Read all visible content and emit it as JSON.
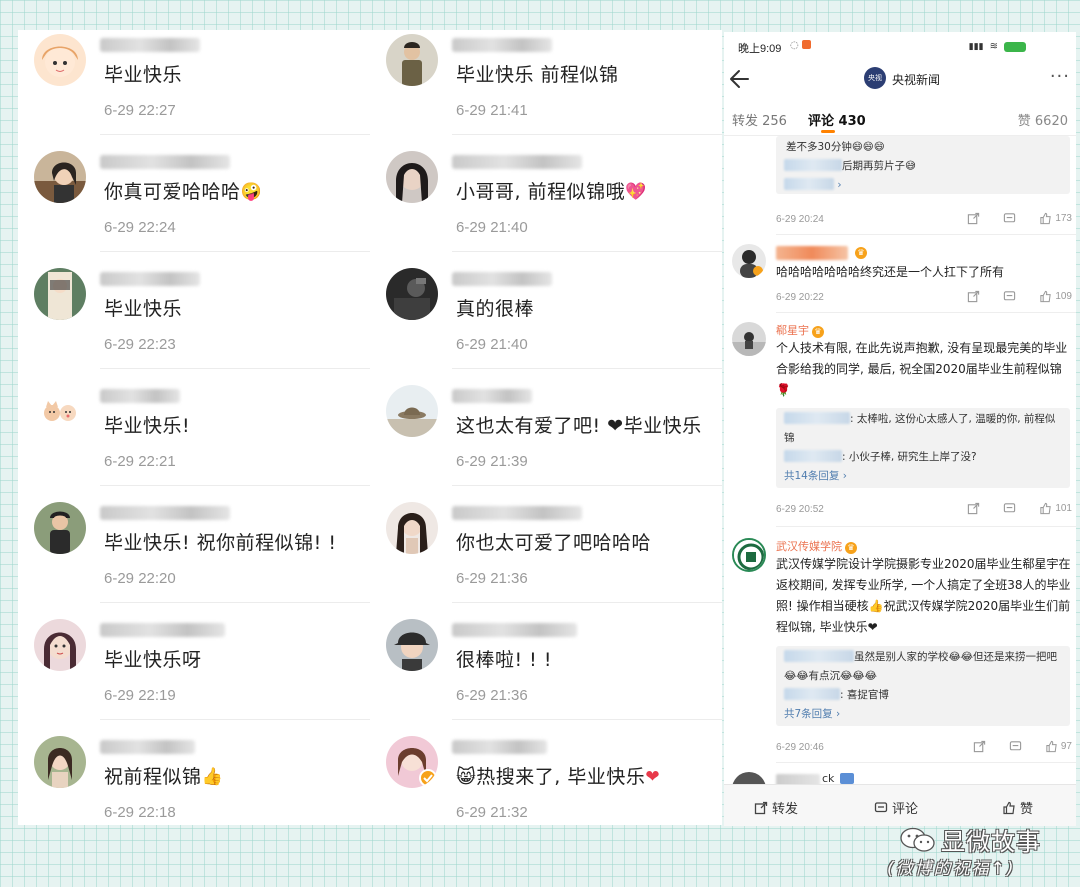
{
  "left_column": [
    {
      "text": "毕业快乐",
      "time": "6-29 22:27",
      "avatar": "cartoon-girl-avatar",
      "emoji": ""
    },
    {
      "text": "你真可爱哈哈哈",
      "time": "6-29 22:24",
      "avatar": "girl-photo-avatar",
      "emoji": "🤪"
    },
    {
      "text": "毕业快乐",
      "time": "6-29 22:23",
      "avatar": "anime-avatar",
      "emoji": ""
    },
    {
      "text": "毕业快乐!",
      "time": "6-29 22:21",
      "avatar": "cats-avatar",
      "emoji": ""
    },
    {
      "text": "毕业快乐! 祝你前程似锦! !",
      "time": "6-29 22:20",
      "avatar": "child-photo-avatar",
      "emoji": ""
    },
    {
      "text": "毕业快乐呀",
      "time": "6-29 22:19",
      "avatar": "girl-selfie-avatar",
      "emoji": ""
    },
    {
      "text": "祝前程似锦",
      "time": "6-29 22:18",
      "avatar": "girl-portrait-avatar",
      "emoji": "👍"
    }
  ],
  "middle_column": [
    {
      "text": "毕业快乐 前程似锦",
      "time": "6-29 21:41",
      "avatar": "man-photo-avatar",
      "emoji": ""
    },
    {
      "text": "小哥哥, 前程似锦哦",
      "time": "6-29 21:40",
      "avatar": "dark-portrait-avatar",
      "emoji": "💖"
    },
    {
      "text": "真的很棒",
      "time": "6-29 21:40",
      "avatar": "dark-scene-avatar",
      "emoji": ""
    },
    {
      "text": "这也太有爱了吧! ❤毕业快乐",
      "time": "6-29 21:39",
      "avatar": "hat-scene-avatar",
      "emoji": ""
    },
    {
      "text": "你也太可爱了吧哈哈哈",
      "time": "6-29 21:36",
      "avatar": "long-hair-girl-avatar",
      "emoji": ""
    },
    {
      "text": "很棒啦! ! !",
      "time": "6-29 21:36",
      "avatar": "boy-cap-avatar",
      "emoji": ""
    },
    {
      "text": "😸热搜来了, 毕业快乐",
      "time": "6-29 21:32",
      "avatar": "girl-verified-avatar",
      "emoji": "❤"
    }
  ],
  "phone": {
    "status": {
      "time": "晚上9:09"
    },
    "nav": {
      "title": "央视新闻",
      "logo": "央视",
      "back_icon": "back-arrow-icon",
      "more": "···"
    },
    "tabs": {
      "repost": "转发 256",
      "comments": "评论 430",
      "likes": "赞 6620"
    },
    "comment0": {
      "quote_line1": "差不多30分钟😄😄😄",
      "quote_line2": "后期再剪片子😅",
      "quote_more": "›",
      "time": "6-29 20:24",
      "likes": "173"
    },
    "comment1": {
      "text": "哈哈哈哈哈哈哈终究还是一个人扛下了所有",
      "time": "6-29 20:22",
      "likes": "109"
    },
    "comment2": {
      "name": "郗星宇",
      "text": "个人技术有限, 在此先说声抱歉, 没有呈现最完美的毕业合影给我的同学, 最后, 祝全国2020届毕业生前程似锦🌹",
      "reply1": ": 太棒啦, 这份心太感人了, 温暖的你, 前程似锦",
      "reply2": ": 小伙子棒, 研究生上岸了没?",
      "replies_link": "共14条回复 ›",
      "time": "6-29 20:52",
      "likes": "101"
    },
    "comment3": {
      "name": "武汉传媒学院",
      "text": "武汉传媒学院设计学院摄影专业2020届毕业生郗星宇在返校期间, 发挥专业所学, 一个人搞定了全班38人的毕业照! 操作相当硬核👍祝武汉传媒学院2020届毕业生们前程似锦, 毕业快乐❤",
      "reply1": "虽然是别人家的学校😂😂但还是来捞一把吧😂😂有点沉😂😂😂",
      "reply2": ": 喜捉官博",
      "replies_link": "共7条回复 ›",
      "time": "6-29 20:46",
      "likes": "97"
    },
    "comment4": {
      "name_fragment": "ck"
    },
    "bottom": {
      "repost": "转发",
      "comment": "评论",
      "like": "赞"
    }
  },
  "watermark": {
    "title": "显微故事",
    "subtitle": "(微博的祝福↑)"
  }
}
